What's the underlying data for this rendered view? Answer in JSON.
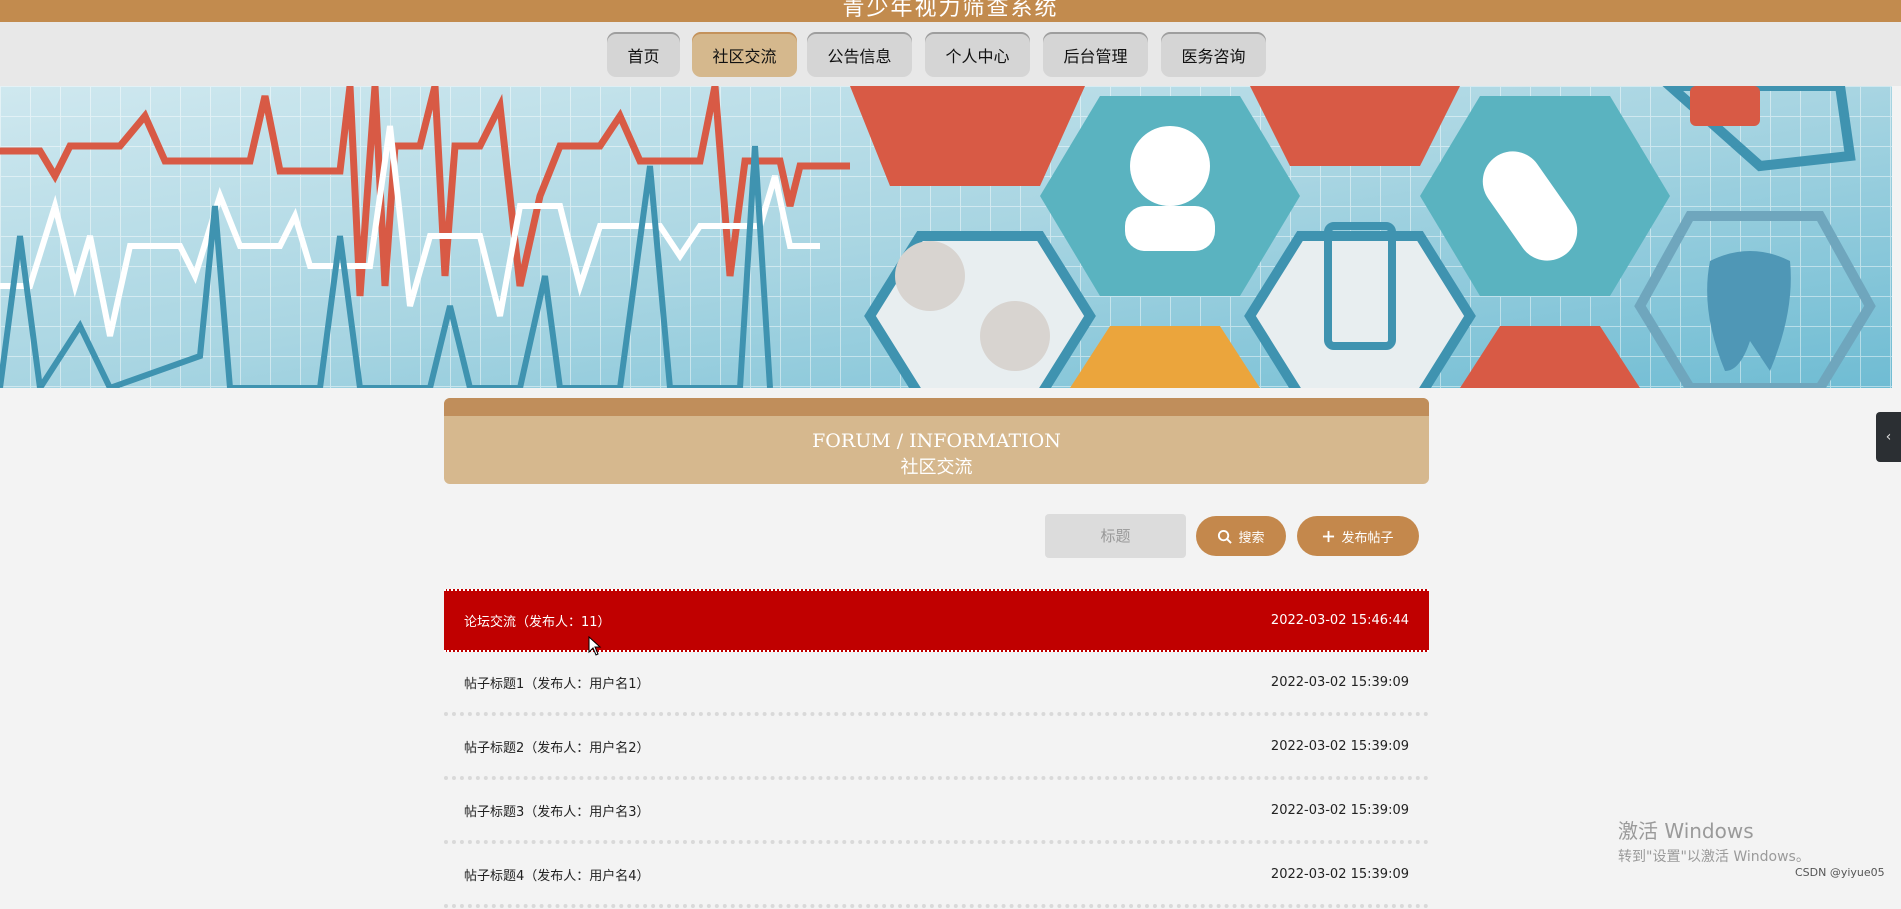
{
  "header": {
    "site_title": "青少年视力筛查系统"
  },
  "nav": {
    "items": [
      {
        "label": "首页",
        "active": false
      },
      {
        "label": "社区交流",
        "active": true
      },
      {
        "label": "公告信息",
        "active": false
      },
      {
        "label": "个人中心",
        "active": false
      },
      {
        "label": "后台管理",
        "active": false
      },
      {
        "label": "医务咨询",
        "active": false
      }
    ]
  },
  "banner": {
    "theme": "medical hexagon icons with heartbeat lines"
  },
  "section": {
    "title_en": "FORUM / INFORMATION",
    "title_cn": "社区交流"
  },
  "search": {
    "placeholder": "标题",
    "search_label": "搜索",
    "publish_label": "发布帖子"
  },
  "posts": [
    {
      "title": "论坛交流（发布人：11）",
      "time": "2022-03-02 15:46:44",
      "highlighted": true
    },
    {
      "title": "帖子标题1（发布人：用户名1）",
      "time": "2022-03-02 15:39:09",
      "highlighted": false
    },
    {
      "title": "帖子标题2（发布人：用户名2）",
      "time": "2022-03-02 15:39:09",
      "highlighted": false
    },
    {
      "title": "帖子标题3（发布人：用户名3）",
      "time": "2022-03-02 15:39:09",
      "highlighted": false
    },
    {
      "title": "帖子标题4（发布人：用户名4）",
      "time": "2022-03-02 15:39:09",
      "highlighted": false
    }
  ],
  "watermark": {
    "line1": "激活 Windows",
    "line2": "转到\"设置\"以激活 Windows。"
  },
  "credit": "CSDN @yiyue05",
  "colors": {
    "brand": "#c28b4e",
    "panel": "#d6b88e",
    "highlight": "#c00000",
    "button": "#c4884c"
  }
}
